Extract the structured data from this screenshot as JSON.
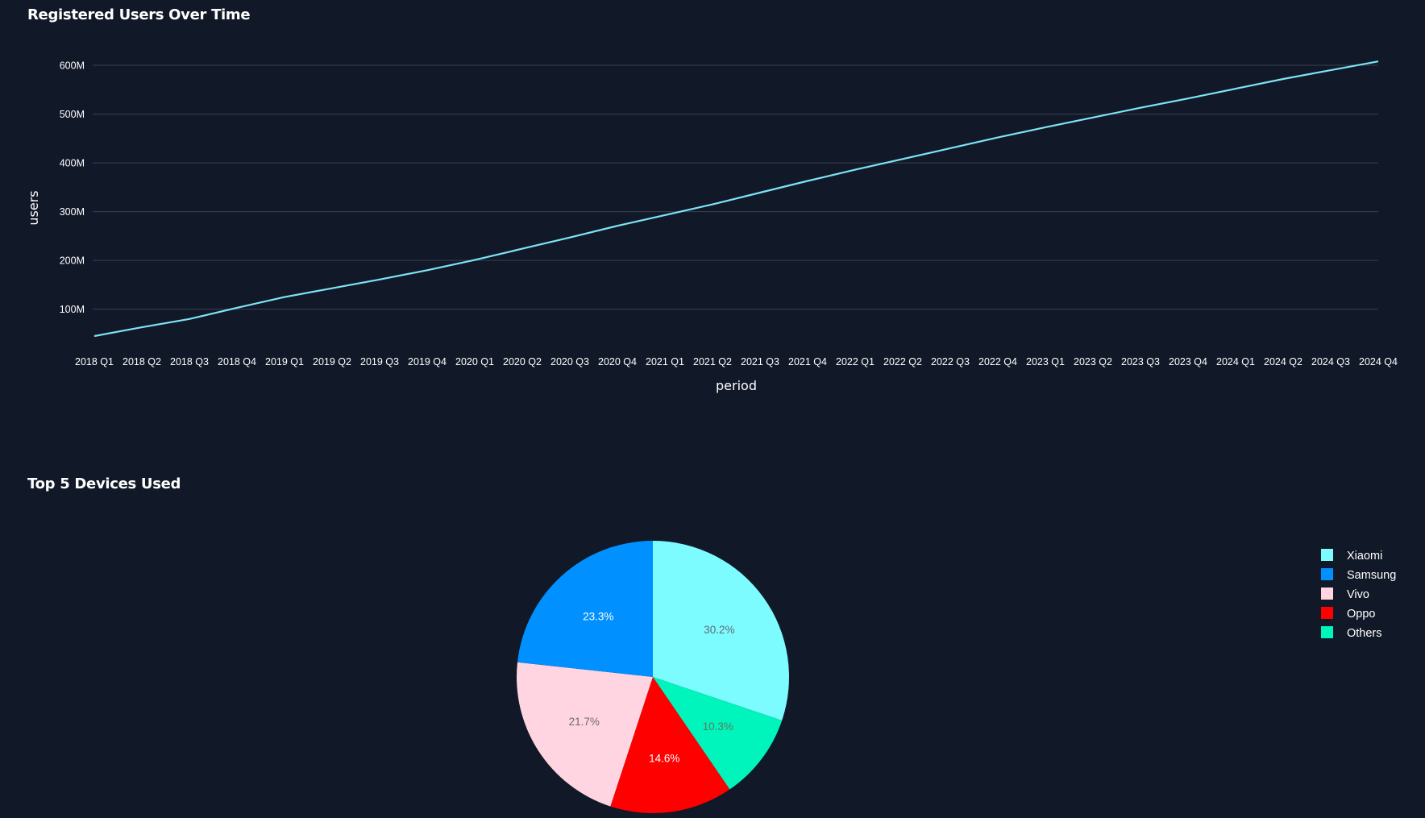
{
  "line_section": {
    "title": "Registered Users Over Time"
  },
  "pie_section": {
    "title": "Top 5 Devices Used"
  },
  "chart_data": [
    {
      "type": "line",
      "title": "Registered Users Over Time",
      "xlabel": "period",
      "ylabel": "users",
      "y_tick_labels": [
        "100M",
        "200M",
        "300M",
        "400M",
        "500M",
        "600M"
      ],
      "y_ticks": [
        100,
        200,
        300,
        400,
        500,
        600
      ],
      "ylim": [
        40,
        610
      ],
      "grid": true,
      "line_color": "#7DE3F5",
      "categories": [
        "2018 Q1",
        "2018 Q2",
        "2018 Q3",
        "2018 Q4",
        "2019 Q1",
        "2019 Q2",
        "2019 Q3",
        "2019 Q4",
        "2020 Q1",
        "2020 Q2",
        "2020 Q3",
        "2020 Q4",
        "2021 Q1",
        "2021 Q2",
        "2021 Q3",
        "2021 Q4",
        "2022 Q1",
        "2022 Q2",
        "2022 Q3",
        "2022 Q4",
        "2023 Q1",
        "2023 Q2",
        "2023 Q3",
        "2023 Q4",
        "2024 Q1",
        "2024 Q2",
        "2024 Q3",
        "2024 Q4"
      ],
      "series": [
        {
          "values": [
            45,
            63,
            80,
            103,
            125,
            143,
            161,
            180,
            201,
            224,
            247,
            271,
            293,
            315,
            339,
            363,
            386,
            408,
            430,
            452,
            473,
            493,
            513,
            532,
            552,
            572,
            590,
            608
          ]
        }
      ]
    },
    {
      "type": "pie",
      "title": "Top 5 Devices Used",
      "legend_position": "top-right",
      "slices": [
        {
          "label": "Xiaomi",
          "value": 30.2,
          "text": "30.2%",
          "color": "#7CFCFF",
          "text_color": "#5E6B78"
        },
        {
          "label": "Others",
          "value": 10.3,
          "text": "10.3%",
          "color": "#00F5BC",
          "text_color": "#5E7A5A"
        },
        {
          "label": "Oppo",
          "value": 14.6,
          "text": "14.6%",
          "color": "#FF0000",
          "text_color": "#FFFFFF"
        },
        {
          "label": "Vivo",
          "value": 21.7,
          "text": "21.7%",
          "color": "#FFD5E1",
          "text_color": "#6B6B75"
        },
        {
          "label": "Samsung",
          "value": 23.3,
          "text": "23.3%",
          "color": "#0090FF",
          "text_color": "#FFFFFF"
        }
      ],
      "legend_order": [
        "Xiaomi",
        "Samsung",
        "Vivo",
        "Oppo",
        "Others"
      ]
    }
  ]
}
